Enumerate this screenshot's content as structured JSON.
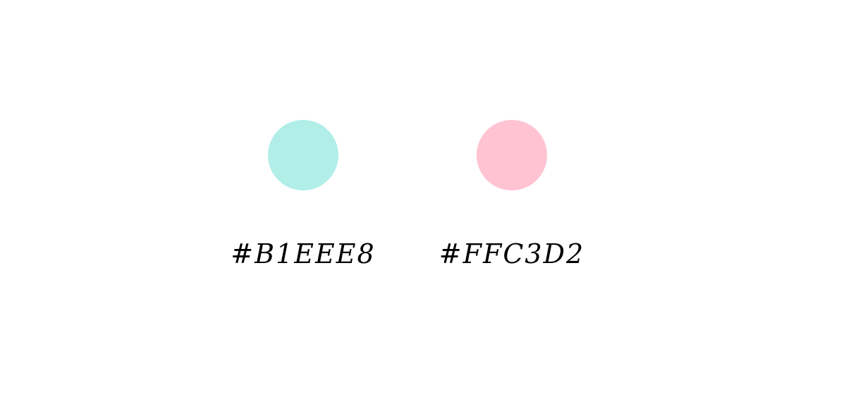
{
  "swatches": [
    {
      "hex_label": "#B1EEE8",
      "color": "#B1EEE8"
    },
    {
      "hex_label": "#FFC3D2",
      "color": "#FFC3D2"
    }
  ]
}
